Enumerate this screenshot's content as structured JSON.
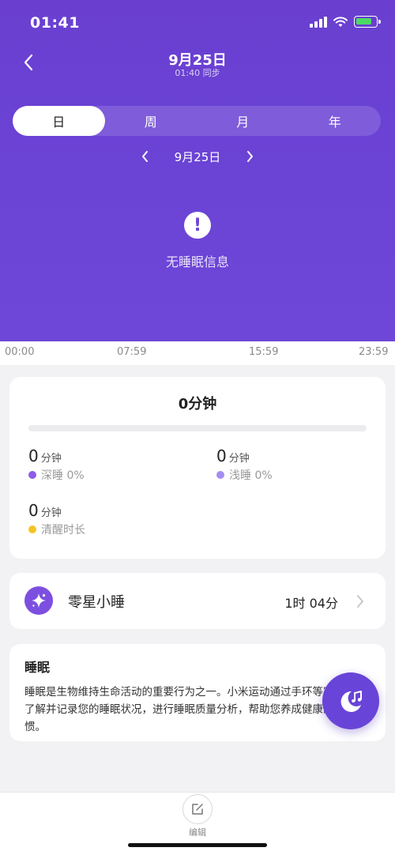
{
  "status": {
    "time": "01:41"
  },
  "header": {
    "title": "9月25日",
    "sync": "01:40 同步"
  },
  "tabs": [
    {
      "label": "日",
      "active": true
    },
    {
      "label": "周",
      "active": false
    },
    {
      "label": "月",
      "active": false
    },
    {
      "label": "年",
      "active": false
    }
  ],
  "date_nav": {
    "date": "9月25日"
  },
  "empty_state": {
    "message": "无睡眠信息"
  },
  "timeline": {
    "labels": [
      "00:00",
      "07:59",
      "15:59",
      "23:59"
    ]
  },
  "summary": {
    "total": "0分钟",
    "deep": {
      "value": "0",
      "unit": "分钟",
      "label": "深睡 0%",
      "color": "#8e5ce6"
    },
    "light": {
      "value": "0",
      "unit": "分钟",
      "label": "浅睡 0%",
      "color": "#a58cf0"
    },
    "awake": {
      "value": "0",
      "unit": "分钟",
      "label": "清醒时长",
      "color": "#f5c325"
    }
  },
  "nap": {
    "title": "零星小睡",
    "value": "1时 04分",
    "icon": "sparkle-icon"
  },
  "info": {
    "title": "睡眠",
    "text": "睡眠是生物维持生命活动的重要行为之一。小米运动通过手环等穿戴设备了解并记录您的睡眠状况，进行睡眠质量分析，帮助您养成健康的睡眠习惯。"
  },
  "bottom": {
    "edit_label": "编辑"
  },
  "colors": {
    "primary": "#6b44d6",
    "accent": "#7d4fe0"
  }
}
